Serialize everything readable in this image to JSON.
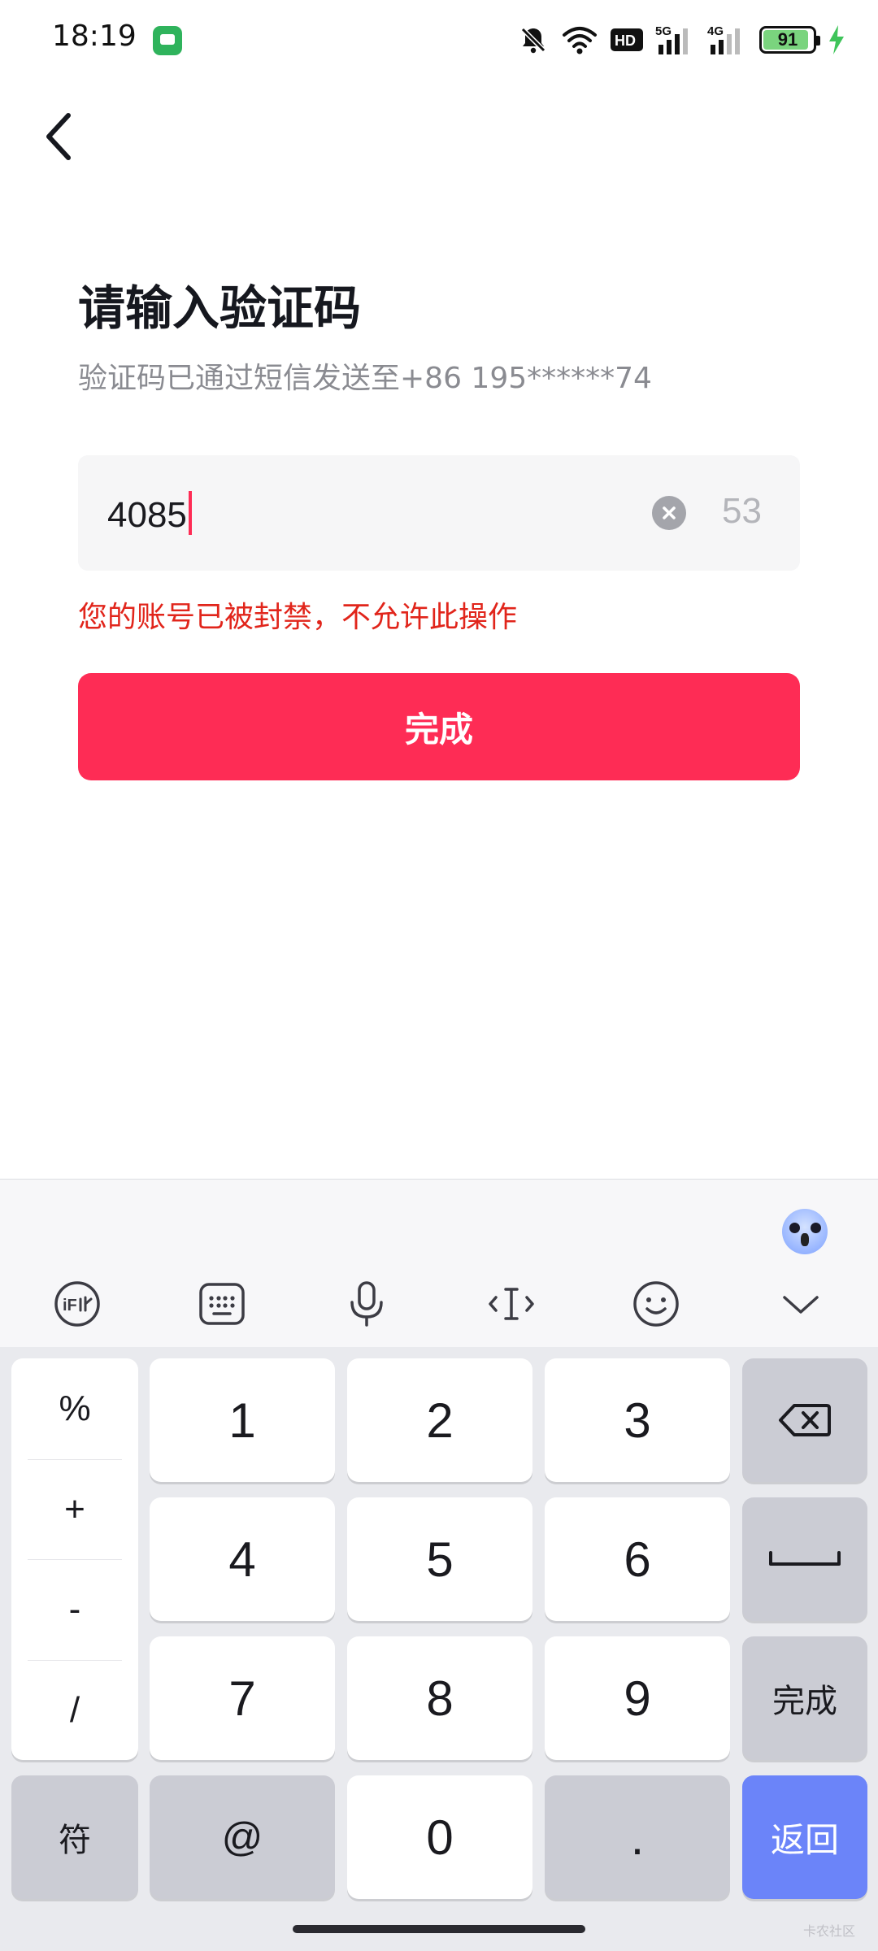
{
  "status_bar": {
    "time": "18:19",
    "battery": 91,
    "icons": [
      "message-app-icon",
      "mute-icon",
      "wifi-icon",
      "hd-icon",
      "5g-signal-icon",
      "4g-signal-icon",
      "battery-icon",
      "charging-icon"
    ],
    "hd_label": "HD",
    "sig1_label": "5G",
    "sig2_label": "4G"
  },
  "header": {
    "title": "请输入验证码",
    "subtitle": "验证码已通过短信发送至+86 195******74"
  },
  "code_input": {
    "value": "4085",
    "countdown": "53"
  },
  "error_message": "您的账号已被封禁，不允许此操作",
  "submit_label": "完成",
  "keyboard": {
    "symbols": [
      "%",
      "+",
      "-",
      "/"
    ],
    "digits": [
      "1",
      "2",
      "3",
      "4",
      "5",
      "6",
      "7",
      "8",
      "9",
      "0"
    ],
    "symbol_key": "符",
    "at_key": "@",
    "dot_key": ".",
    "done_key": "完成",
    "return_key": "返回"
  },
  "watermark": "卡农社区",
  "colors": {
    "accent": "#fe2c55",
    "error": "#e1251b",
    "return_key": "#6b84f9"
  }
}
